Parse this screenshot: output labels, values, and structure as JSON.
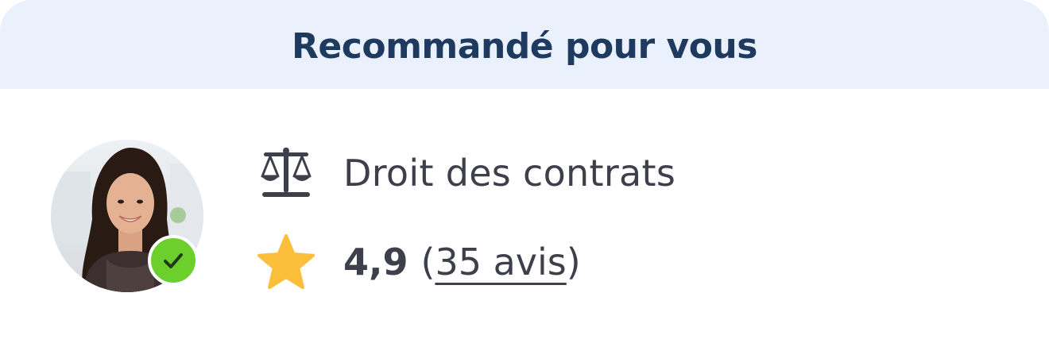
{
  "header": {
    "title": "Recommandé pour vous"
  },
  "lawyer": {
    "avatar_alt": "Portrait photo",
    "verified": true,
    "specialty": "Droit des contrats",
    "specialty_icon": "scales-icon",
    "rating_icon": "star-icon",
    "rating": "4,9",
    "paren_open": "(",
    "reviews_label": "35 avis",
    "paren_close": ")"
  },
  "colors": {
    "header_bg": "#eaf1fd",
    "header_text": "#1e3a5f",
    "body_text": "#3d3f4a",
    "star": "#fbbf3c",
    "verified_badge": "#6ccf2c"
  }
}
